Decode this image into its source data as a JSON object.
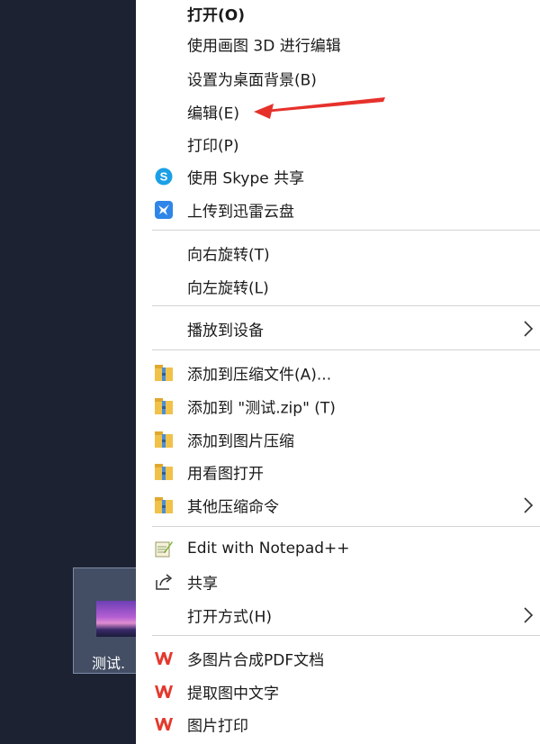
{
  "desktop": {
    "file_name": "测试."
  },
  "menu": {
    "items": [
      {
        "label": "打开(O)"
      },
      {
        "label": "使用画图 3D 进行编辑"
      },
      {
        "label": "设置为桌面背景(B)"
      },
      {
        "label": "编辑(E)"
      },
      {
        "label": "打印(P)"
      },
      {
        "label": "使用 Skype 共享",
        "icon": "skype-icon"
      },
      {
        "label": "上传到迅雷云盘",
        "icon": "thunder-cloud-icon"
      },
      {
        "label": "向右旋转(T)"
      },
      {
        "label": "向左旋转(L)"
      },
      {
        "label": "播放到设备"
      },
      {
        "label": "添加到压缩文件(A)...",
        "icon": "archive-icon"
      },
      {
        "label": "添加到 \"测试.zip\" (T)",
        "icon": "archive-icon"
      },
      {
        "label": "添加到图片压缩",
        "icon": "archive-icon"
      },
      {
        "label": "用看图打开",
        "icon": "archive-icon"
      },
      {
        "label": "其他压缩命令",
        "icon": "archive-icon"
      },
      {
        "label": "Edit with Notepad++",
        "icon": "notepad-plus-plus-icon"
      },
      {
        "label": "共享",
        "icon": "share-icon"
      },
      {
        "label": "打开方式(H)"
      },
      {
        "label": "多图片合成PDF文档",
        "icon": "wps-icon"
      },
      {
        "label": "提取图中文字",
        "icon": "wps-icon"
      },
      {
        "label": "图片打印",
        "icon": "wps-icon"
      }
    ]
  },
  "colors": {
    "desktop_bg": "#1d2232",
    "menu_bg": "#ffffff",
    "arrow": "#e6312b",
    "skype": "#1aa0e6",
    "wps": "#e4392e"
  }
}
